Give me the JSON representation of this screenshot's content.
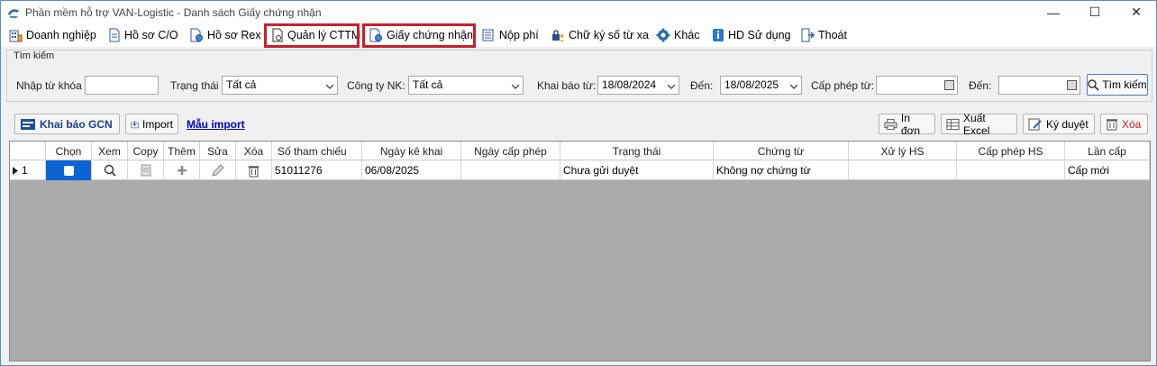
{
  "window": {
    "title": "Phần mềm hỗ trợ VAN-Logistic - Danh sách Giấy chứng nhận",
    "minimize": "—",
    "maximize": "☐",
    "close": "✕"
  },
  "menu": {
    "items": [
      {
        "label": "Doanh nghiệp",
        "icon": "building-icon"
      },
      {
        "label": "Hồ sơ C/O",
        "icon": "document-icon"
      },
      {
        "label": "Hồ sơ Rex",
        "icon": "document-gear-icon"
      },
      {
        "label": "Quản lý CTTM",
        "icon": "document-search-icon"
      },
      {
        "label": "Giấy chứng nhận",
        "icon": "certificate-icon"
      },
      {
        "label": "Nộp phí",
        "icon": "receipt-icon"
      },
      {
        "label": "Chữ ký số từ xa",
        "icon": "lock-user-icon"
      },
      {
        "label": "Khác",
        "icon": "gear-icon"
      },
      {
        "label": "HD Sử dụng",
        "icon": "info-icon"
      },
      {
        "label": "Thoát",
        "icon": "exit-icon"
      }
    ],
    "highlight_color": "#cc1f2b"
  },
  "search": {
    "legend": "Tìm kiếm",
    "keyword_label": "Nhập từ khóa",
    "keyword_value": "",
    "status_label": "Trạng thái",
    "status_value": "Tất cả",
    "company_label": "Công ty NK:",
    "company_value": "Tất cả",
    "declare_from_label": "Khai báo từ:",
    "declare_from_value": "18/08/2024",
    "to_label_1": "Đến:",
    "declare_to_value": "18/08/2025",
    "permit_from_label": "Cấp phép từ:",
    "permit_from_value": "",
    "to_label_2": "Đến:",
    "permit_to_value": "",
    "search_button": "Tìm kiếm"
  },
  "toolbar": {
    "declare_gcn": "Khai báo GCN",
    "import": "Import",
    "template_import": "Mẫu import",
    "print": "In đơn",
    "export_excel": "Xuất Excel",
    "sign": "Ký duyệt",
    "delete": "Xóa"
  },
  "grid": {
    "columns": [
      "",
      "Chọn",
      "Xem",
      "Copy",
      "Thêm",
      "Sửa",
      "Xóa",
      "Số tham chiếu",
      "Ngày kê khai",
      "Ngày cấp phép",
      "Trạng thái",
      "Chứng từ",
      "Xử lý HS",
      "Cấp phép HS",
      "Lần cấp"
    ],
    "rows": [
      {
        "index": "1",
        "ref": "51011276",
        "declare_date": "06/08/2025",
        "permit_date": "",
        "status": "Chưa gửi duyệt",
        "documents": "Không nợ chứng từ",
        "processing": "",
        "permit": "",
        "issue": "Cấp mới"
      }
    ],
    "selection_color": "#0a64d2",
    "empty_bg": "#ababab"
  }
}
